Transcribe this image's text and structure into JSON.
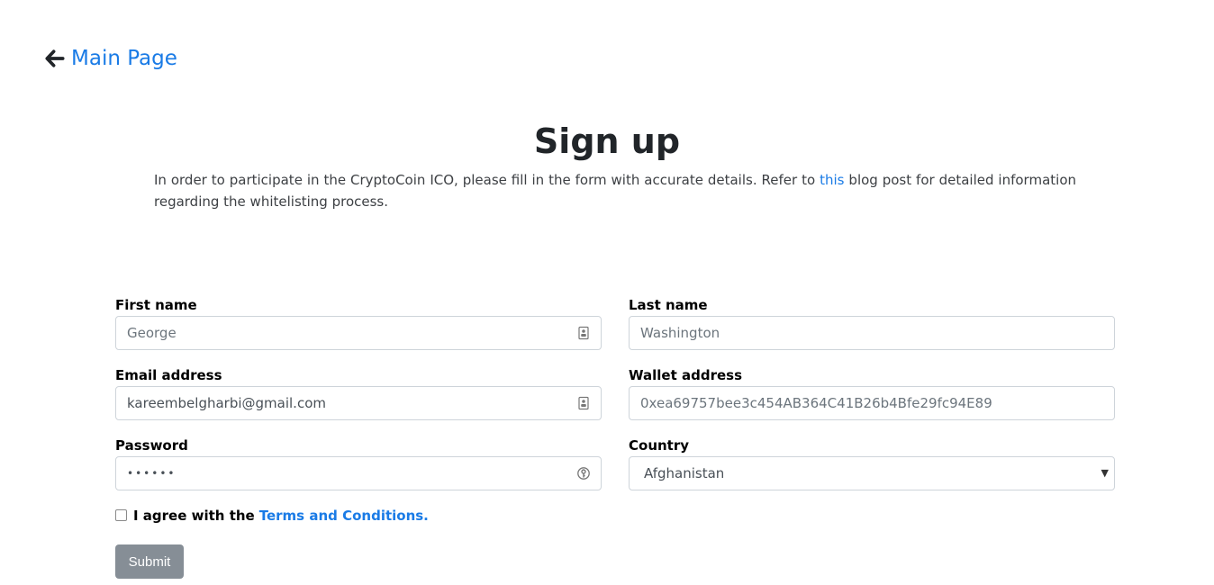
{
  "nav": {
    "back_label": "Main Page"
  },
  "title": "Sign up",
  "intro": {
    "before": "In order to participate in the CryptoCoin ICO, please fill in the form with accurate details. Refer to",
    "link": "this",
    "after": "blog post for detailed information regarding the whitelisting process."
  },
  "form": {
    "first_name": {
      "label": "First name",
      "value": "",
      "placeholder": "George"
    },
    "last_name": {
      "label": "Last name",
      "value": "",
      "placeholder": "Washington"
    },
    "email": {
      "label": "Email address",
      "value": "kareembelgharbi@gmail.com",
      "placeholder": ""
    },
    "wallet": {
      "label": "Wallet address",
      "value": "",
      "placeholder": "0xea69757bee3c454AB364C41B26b4Bfe29fc94E89"
    },
    "password": {
      "label": "Password",
      "value": "••••••"
    },
    "country": {
      "label": "Country",
      "selected": "Afghanistan"
    },
    "agree": {
      "text": "I agree with the",
      "link": "Terms and Conditions.",
      "checked": false
    },
    "submit_label": "Submit"
  },
  "icons": {
    "back": "arrow-left-icon",
    "autofill": "contact-card-icon",
    "password_manager": "key-icon",
    "dropdown": "caret-down-icon"
  },
  "colors": {
    "link": "#1a7be6",
    "submit_bg": "#868e96",
    "border": "#ced4da"
  }
}
